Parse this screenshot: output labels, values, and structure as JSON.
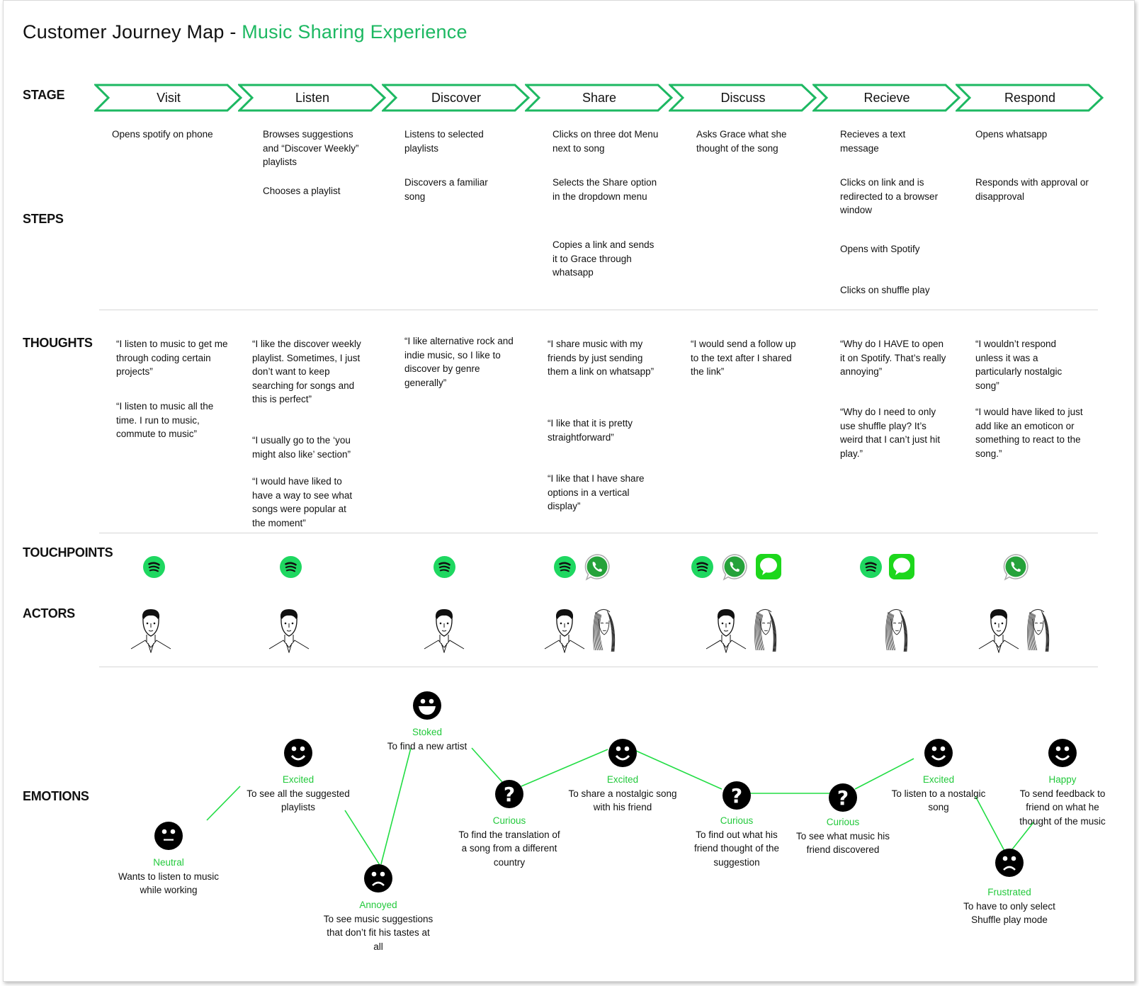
{
  "title": {
    "prefix": "Customer Journey Map - ",
    "accent": "Music Sharing Experience"
  },
  "colors": {
    "accent": "#1db862",
    "emotion_label": "#22c93b",
    "line": "#22dd44",
    "spotify": "#1ed760",
    "whatsapp": "#25a23a",
    "imessage": "#1dd71c"
  },
  "row_labels": {
    "stage": "STAGE",
    "steps": "STEPS",
    "thoughts": "THOUGHTS",
    "touchpoints": "TOUCHPOINTS",
    "actors": "ACTORS",
    "emotions": "EMOTIONS"
  },
  "stages": [
    {
      "name": "Visit",
      "steps": [
        "Opens spotify on phone"
      ],
      "thoughts": [
        "“I  listen to music to get me through coding certain projects”",
        "“I  listen to music all the time. I run to music, commute to music”"
      ],
      "touchpoints": [
        "spotify-icon"
      ],
      "actors": [
        "male-user-avatar"
      ]
    },
    {
      "name": "Listen",
      "steps": [
        "Browses suggestions and “Discover Weekly” playlists",
        "Chooses a playlist"
      ],
      "thoughts": [
        "“I like the discover weekly playlist. Sometimes, I just don’t want to keep searching for songs and this is perfect”",
        "“I usually go to the ‘you might also like’ section”",
        "“I would have liked to have a way to see what songs were popular at the moment”"
      ],
      "touchpoints": [
        "spotify-icon"
      ],
      "actors": [
        "male-user-avatar"
      ]
    },
    {
      "name": "Discover",
      "steps": [
        "Listens to selected playlists",
        "Discovers a familiar song"
      ],
      "thoughts": [
        "“I like alternative rock and indie music, so I like to discover by genre generally”"
      ],
      "touchpoints": [
        "spotify-icon"
      ],
      "actors": [
        "male-user-avatar"
      ]
    },
    {
      "name": "Share",
      "steps": [
        "Clicks on three dot Menu next to song",
        "Selects the Share option in the dropdown menu",
        "Copies a link and sends it to Grace through whatsapp"
      ],
      "thoughts": [
        "“I share music with my friends by just sending them a link on whatsapp”",
        "“I like that it is pretty straightforward”",
        "“I like that I have share options in a vertical display”"
      ],
      "touchpoints": [
        "spotify-icon",
        "whatsapp-icon"
      ],
      "actors": [
        "male-user-avatar",
        "female-friend-avatar"
      ]
    },
    {
      "name": "Discuss",
      "steps": [
        "Asks Grace what she thought of the song"
      ],
      "thoughts": [
        "“I would send a follow up to the text after I shared the link”"
      ],
      "touchpoints": [
        "spotify-icon",
        "whatsapp-icon",
        "imessage-icon"
      ],
      "actors": [
        "male-user-avatar",
        "female-friend-avatar"
      ]
    },
    {
      "name": "Recieve",
      "steps": [
        "Recieves a text message",
        "Clicks on link and is redirected to a browser window",
        "Opens with Spotify",
        "Clicks on shuffle play"
      ],
      "thoughts": [
        "“Why do I HAVE to open it on Spotify. That’s really annoying”",
        "“Why do I need to only use shuffle play? It’s weird that I can’t just hit play.”"
      ],
      "touchpoints": [
        "spotify-icon",
        "imessage-icon"
      ],
      "actors": [
        "female-friend-avatar"
      ]
    },
    {
      "name": "Respond",
      "steps": [
        "Opens whatsapp",
        "Responds with approval or disapproval"
      ],
      "thoughts": [
        "“I wouldn’t respond unless it was a particularly nostalgic song”",
        "“I would have liked to just add like an emoticon or something to react to the song.”"
      ],
      "touchpoints": [
        "whatsapp-icon"
      ],
      "actors": [
        "male-user-avatar",
        "female-friend-avatar"
      ]
    }
  ],
  "emotions": [
    {
      "face": "neutral",
      "label": "Neutral",
      "desc": "Wants to listen to music while working"
    },
    {
      "face": "smile",
      "label": "Excited",
      "desc": "To see all the suggested playlists"
    },
    {
      "face": "sad",
      "label": "Annoyed",
      "desc": "To see music suggestions that don’t fit his tastes at all"
    },
    {
      "face": "grin",
      "label": "Stoked",
      "desc": "To find a new artist"
    },
    {
      "face": "question",
      "label": "Curious",
      "desc": "To find the translation of a song from a different country"
    },
    {
      "face": "smile",
      "label": "Excited",
      "desc": "To share a nostalgic song with his friend"
    },
    {
      "face": "question",
      "label": "Curious",
      "desc": "To find out what his friend thought of the suggestion"
    },
    {
      "face": "question",
      "label": "Curious",
      "desc": "To see what music his friend discovered"
    },
    {
      "face": "smile",
      "label": "Excited",
      "desc": "To listen to a nostalgic song"
    },
    {
      "face": "sad",
      "label": "Frustrated",
      "desc": "To have to only select Shuffle play mode"
    },
    {
      "face": "smile",
      "label": "Happy",
      "desc": "To send feedback to friend on what he thought of the music"
    }
  ]
}
